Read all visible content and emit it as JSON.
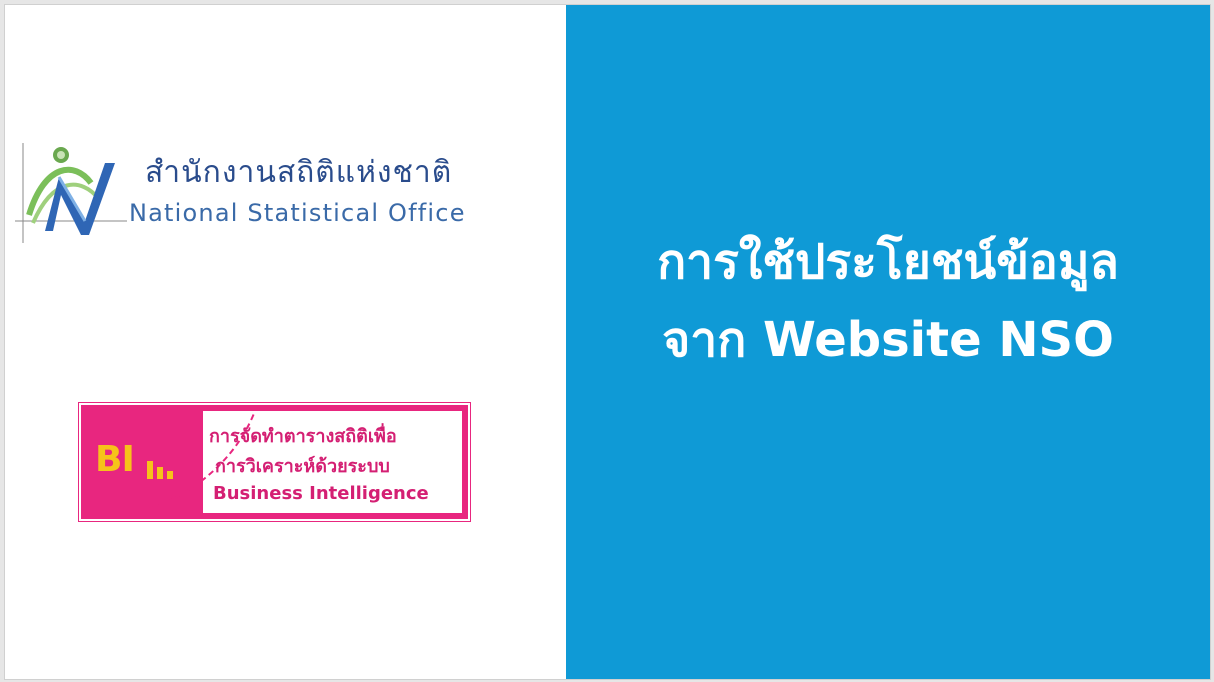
{
  "slide": {
    "left": {
      "nso_logo": {
        "thai_name": "สำนักงานสถิติแห่งชาติ",
        "english_name": "National Statistical Office",
        "icon": "nso-emblem-icon"
      },
      "bi_logo": {
        "mark": "BI",
        "line1": "การจัดทำตารางสถิติเพื่อ",
        "line2": "การวิเคราะห์ด้วยระบบ",
        "line3": "Business Intelligence",
        "color": "#e8267f",
        "accent": "#f6c21a"
      }
    },
    "right": {
      "background": "#0f9ad6",
      "title_line1": "การใช้ประโยชน์ข้อมูล",
      "title_line2": "จาก Website NSO"
    }
  }
}
